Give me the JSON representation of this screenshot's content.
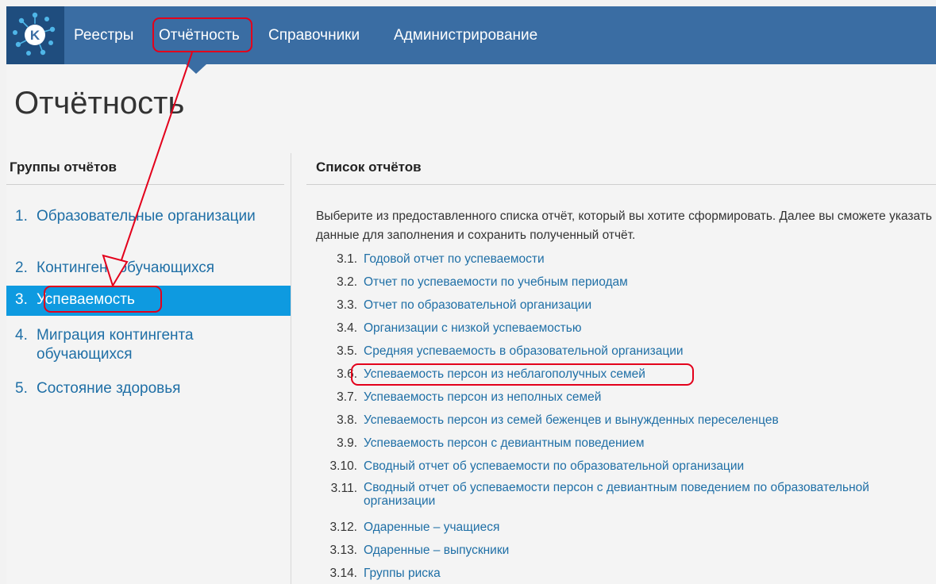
{
  "nav": {
    "items": [
      {
        "label": "Реестры"
      },
      {
        "label": "Отчётность"
      },
      {
        "label": "Справочники"
      },
      {
        "label": "Администрирование"
      }
    ],
    "active_index": 1
  },
  "page": {
    "title": "Отчётность"
  },
  "groups": {
    "heading": "Группы отчётов",
    "items": [
      {
        "number": "1.",
        "label": "Образовательные организации"
      },
      {
        "number": "2.",
        "label": "Контингент обучающихся"
      },
      {
        "number": "3.",
        "label": "Успеваемость"
      },
      {
        "number": "4.",
        "label": "Миграция контингента обучающихся"
      },
      {
        "number": "5.",
        "label": "Состояние здоровья"
      }
    ],
    "active_index": 2
  },
  "reports": {
    "heading": "Список отчётов",
    "intro": "Выберите из предоставленного списка отчёт, который вы хотите сформировать. Далее вы сможете указать данные для заполнения и сохранить полученный отчёт.",
    "items": [
      {
        "number": "3.1.",
        "label": "Годовой отчет по успеваемости"
      },
      {
        "number": "3.2.",
        "label": "Отчет по успеваемости по учебным периодам"
      },
      {
        "number": "3.3.",
        "label": "Отчет по образовательной организации"
      },
      {
        "number": "3.4.",
        "label": "Организации с низкой успеваемостью"
      },
      {
        "number": "3.5.",
        "label": "Средняя успеваемость в образовательной организации"
      },
      {
        "number": "3.6.",
        "label": "Успеваемость персон из неблагополучных семей"
      },
      {
        "number": "3.7.",
        "label": "Успеваемость персон из неполных семей"
      },
      {
        "number": "3.8.",
        "label": "Успеваемость персон из семей беженцев и вынужденных переселенцев"
      },
      {
        "number": "3.9.",
        "label": "Успеваемость персон с девиантным поведением"
      },
      {
        "number": "3.10.",
        "label": "Сводный отчет об успеваемости по образовательной организации"
      },
      {
        "number": "3.11.",
        "label": "Сводный отчет об успеваемости персон с девиантным поведением по образовательной организации"
      },
      {
        "number": "3.12.",
        "label": "Одаренные – учащиеся"
      },
      {
        "number": "3.13.",
        "label": "Одаренные – выпускники"
      },
      {
        "number": "3.14.",
        "label": "Группы риска"
      }
    ]
  },
  "colors": {
    "nav_bg": "#3a6da3",
    "logo_bg": "#1f4d7e",
    "link": "#1f6fa6",
    "active_bg": "#0e9ae0",
    "annotation": "#e3001b"
  },
  "icons": {
    "logo": "app-logo-icon"
  }
}
